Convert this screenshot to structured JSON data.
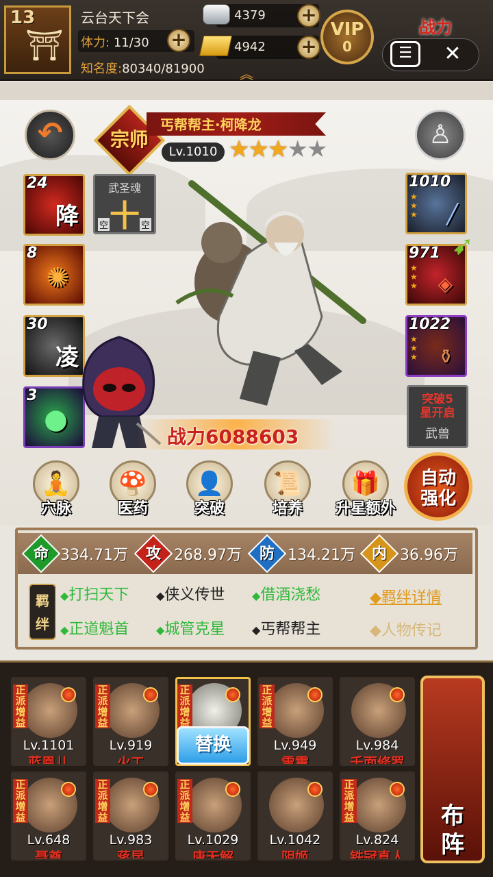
{
  "top": {
    "level": "13",
    "guild": "云台天下会",
    "stamina_label": "体力:",
    "stamina_value": "11/30",
    "fame_label": "知名度:",
    "fame_value": "80340/81900",
    "silver": "4379",
    "gold": "4942",
    "vip_label": "VIP",
    "vip_level": "0",
    "power_tag": "战力"
  },
  "hero": {
    "rank": "宗师",
    "title": "丐帮帮主·柯降龙",
    "level": "Lv.1010",
    "stars_on": 3,
    "stars_total": 5,
    "power_label": "战力",
    "power_value": "6088603"
  },
  "skills": [
    {
      "count": "24",
      "glyph": "降"
    },
    {
      "count": "8",
      "glyph": ""
    },
    {
      "count": "30",
      "glyph": "凌"
    },
    {
      "count": "3",
      "glyph": ""
    }
  ],
  "soul": {
    "title": "武圣魂",
    "center": "十",
    "left": "空",
    "right": "空"
  },
  "equips": [
    {
      "level": "1010"
    },
    {
      "level": "971"
    },
    {
      "level": "1022"
    }
  ],
  "beast": {
    "line1": "突破5",
    "line2": "星开启",
    "label": "武兽"
  },
  "functions": [
    "穴脉",
    "医药",
    "突破",
    "培养",
    "升星额外"
  ],
  "auto_label_1": "自动",
  "auto_label_2": "强化",
  "attributes": [
    {
      "icon": "命",
      "value": "334.71万",
      "color": "#1e9a2a"
    },
    {
      "icon": "攻",
      "value": "268.97万",
      "color": "#c4231a"
    },
    {
      "icon": "防",
      "value": "134.21万",
      "color": "#1f6fc4"
    },
    {
      "icon": "内",
      "value": "36.96万",
      "color": "#d6941a"
    }
  ],
  "bond_tag": "羁绊",
  "bonds_row1": [
    "打扫天下",
    "侠义传世",
    "借酒浇愁"
  ],
  "bonds_row2": [
    "正道魁首",
    "城管克星",
    "丐帮帮主"
  ],
  "bond_details": "◆羁绊详情",
  "bond_story": "◆人物传记",
  "team_tag": "正派增益",
  "team": [
    {
      "level": "Lv.1101",
      "name": "蓝凰儿"
    },
    {
      "level": "Lv.919",
      "name": "火工"
    },
    {
      "level": "",
      "name": ""
    },
    {
      "level": "Lv.949",
      "name": "雷震"
    },
    {
      "level": "Lv.984",
      "name": "千面修罗"
    },
    {
      "level": "Lv.648",
      "name": "聂尊"
    },
    {
      "level": "Lv.983",
      "name": "蒋昆"
    },
    {
      "level": "Lv.1029",
      "name": "唐无解"
    },
    {
      "level": "Lv.1042",
      "name": "阴姬"
    },
    {
      "level": "Lv.824",
      "name": "铁冠真人"
    }
  ],
  "swap_label": "替换",
  "formation_label": "布阵"
}
